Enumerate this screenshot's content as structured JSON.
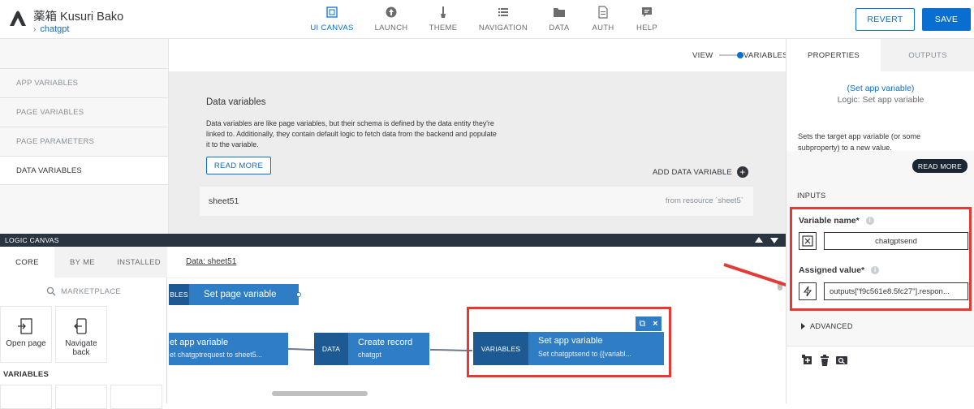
{
  "header": {
    "app_title": "薬箱 Kusuri Bako",
    "breadcrumb": "chatgpt",
    "nav": [
      {
        "label": "UI CANVAS",
        "icon": "ui-canvas-icon",
        "active": true
      },
      {
        "label": "LAUNCH",
        "icon": "launch-icon"
      },
      {
        "label": "THEME",
        "icon": "theme-brush-icon"
      },
      {
        "label": "NAVIGATION",
        "icon": "navigation-list-icon"
      },
      {
        "label": "DATA",
        "icon": "folder-icon"
      },
      {
        "label": "AUTH",
        "icon": "auth-document-icon"
      },
      {
        "label": "HELP",
        "icon": "help-chat-icon"
      }
    ],
    "revert_label": "REVERT",
    "save_label": "SAVE"
  },
  "variables_menu": {
    "items": [
      "APP VARIABLES",
      "PAGE VARIABLES",
      "PAGE PARAMETERS",
      "DATA VARIABLES"
    ],
    "active": "DATA VARIABLES"
  },
  "view_switch": {
    "left_label": "VIEW",
    "right_label": "VARIABLES",
    "selected": "VARIABLES"
  },
  "data_panel": {
    "heading": "Data variables",
    "description": "Data variables are like page variables, but their schema is defined by the data entity they're linked to. Additionally, they contain default logic to fetch data from the backend and populate it to the variable.",
    "read_more": "READ MORE",
    "add_label": "ADD DATA VARIABLE",
    "rows": [
      {
        "name": "sheet51",
        "source": "from resource `sheet5`"
      }
    ]
  },
  "logic_canvas": {
    "title": "LOGIC CANVAS",
    "palette_tabs": [
      "CORE",
      "BY ME",
      "INSTALLED"
    ],
    "active_tab": "CORE",
    "marketplace": "MARKETPLACE",
    "tiles": [
      {
        "label": "Open page",
        "icon": "open-page-icon"
      },
      {
        "label": "Navigate back",
        "icon": "navigate-back-icon"
      }
    ],
    "variables_heading": "VARIABLES",
    "breadcrumb": "Data: sheet51",
    "nodes": {
      "set_page_var": {
        "category": "BLES",
        "title": "Set page variable"
      },
      "set_app_var_1": {
        "title": "et app variable",
        "subtitle": "et chatgptrequest to sheet5..."
      },
      "create_record": {
        "category": "DATA",
        "title": "Create record",
        "subtitle": "chatgpt"
      },
      "set_app_var_2": {
        "category": "VARIABLES",
        "title": "Set app variable",
        "subtitle": "Set chatgptsend to {{variabl..."
      }
    }
  },
  "properties": {
    "tabs": [
      "PROPERTIES",
      "OUTPUTS"
    ],
    "active_tab": "PROPERTIES",
    "title": "(Set app variable)",
    "subtitle": "Logic: Set app variable",
    "description": "Sets the target app variable (or some subproperty) to a new value.",
    "read_more": "READ MORE",
    "inputs_heading": "INPUTS",
    "variable_name_label": "Variable name*",
    "variable_name_value": "chatgptsend",
    "assigned_value_label": "Assigned value*",
    "assigned_value_value": "outputs[\"f9c561e8.5fc27\"].respon...",
    "advanced_label": "ADVANCED"
  },
  "colors": {
    "accent": "#0a6ed1",
    "node": "#2f7dc4",
    "node_category": "#1d5a94",
    "highlight": "#e53935",
    "canvas_bar": "#2a3440"
  }
}
